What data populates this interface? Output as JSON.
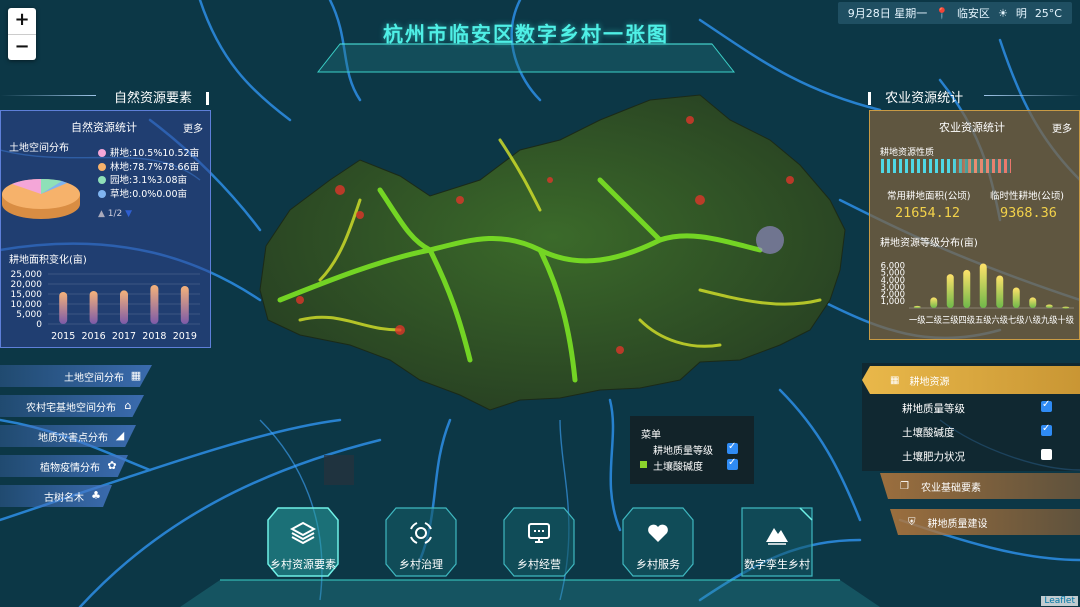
{
  "title": "杭州市临安区数字乡村一张图",
  "topbar": {
    "date": "9月28日 星期一",
    "location": "临安区",
    "weather": "明",
    "temp": "25°C"
  },
  "zoom": {
    "in": "+",
    "out": "−"
  },
  "left": {
    "section_title": "自然资源要素",
    "panel_title": "自然资源统计",
    "more": "更多",
    "land_label": "土地空间分布",
    "legend": [
      {
        "text": "耕地:10.5%10.52亩",
        "color": "#f4a6d8"
      },
      {
        "text": "林地:78.7%78.66亩",
        "color": "#f6b26b"
      },
      {
        "text": "园地:3.1%3.08亩",
        "color": "#8fe0b8"
      },
      {
        "text": "草地:0.0%0.00亩",
        "color": "#7fb4f0"
      }
    ],
    "pager": "1/2",
    "area_label": "耕地面积变化(亩)",
    "area_chart": {
      "type": "bar",
      "categories": [
        "2015",
        "2016",
        "2017",
        "2018",
        "2019"
      ],
      "values": [
        16000,
        16500,
        16800,
        19500,
        19000
      ],
      "yticks": [
        "25,000",
        "20,000",
        "15,000",
        "10,000",
        "5,000",
        "0"
      ],
      "ylim": [
        0,
        25000
      ]
    },
    "nav": [
      {
        "label": "土地空间分布",
        "icon": "grid-icon"
      },
      {
        "label": "农村宅基地空间分布",
        "icon": "home-icon"
      },
      {
        "label": "地质灾害点分布",
        "icon": "slope-icon"
      },
      {
        "label": "植物疫情分布",
        "icon": "plant-icon"
      },
      {
        "label": "古树名木",
        "icon": "tree-icon"
      }
    ]
  },
  "right": {
    "section_title": "农业资源统计",
    "panel_title": "农业资源统计",
    "more": "更多",
    "nature_label": "耕地资源性质",
    "stat1_label": "常用耕地面积(公顷)",
    "stat1_value": "21654.12",
    "stat2_label": "临时性耕地(公顷)",
    "stat2_value": "9368.36",
    "grade_label": "耕地资源等级分布(亩)",
    "grade_chart": {
      "type": "bar",
      "categories": [
        "一级",
        "二级",
        "三级",
        "四级",
        "五级",
        "六级",
        "七级",
        "八级",
        "九级",
        "十级"
      ],
      "values": [
        300,
        1500,
        4800,
        5400,
        6300,
        4600,
        2900,
        1500,
        500,
        200
      ],
      "yticks": [
        "6,000",
        "5,000",
        "4,000",
        "3,000",
        "2,000",
        "1,000"
      ],
      "xtick_text": "一级二级三级四级五级六级七级八级九级十级",
      "ylim": [
        0,
        6800
      ]
    },
    "layer_head": "耕地资源",
    "layers": [
      {
        "label": "耕地质量等级",
        "checked": true
      },
      {
        "label": "土壤酸碱度",
        "checked": true
      },
      {
        "label": "土壤肥力状况",
        "checked": false
      }
    ],
    "btn1": "农业基础要素",
    "btn2": "耕地质量建设"
  },
  "menu": {
    "title": "菜单",
    "items": [
      {
        "label": "耕地质量等级",
        "checked": true
      },
      {
        "label": "土壤酸碱度",
        "checked": true
      }
    ]
  },
  "bottom": [
    {
      "label": "乡村资源要素",
      "icon": "layers-icon"
    },
    {
      "label": "乡村治理",
      "icon": "governance-icon"
    },
    {
      "label": "乡村经营",
      "icon": "business-icon"
    },
    {
      "label": "乡村服务",
      "icon": "heart-icon"
    },
    {
      "label": "数字孪生乡村",
      "icon": "mountain-icon"
    }
  ],
  "attribution": "Leaflet"
}
